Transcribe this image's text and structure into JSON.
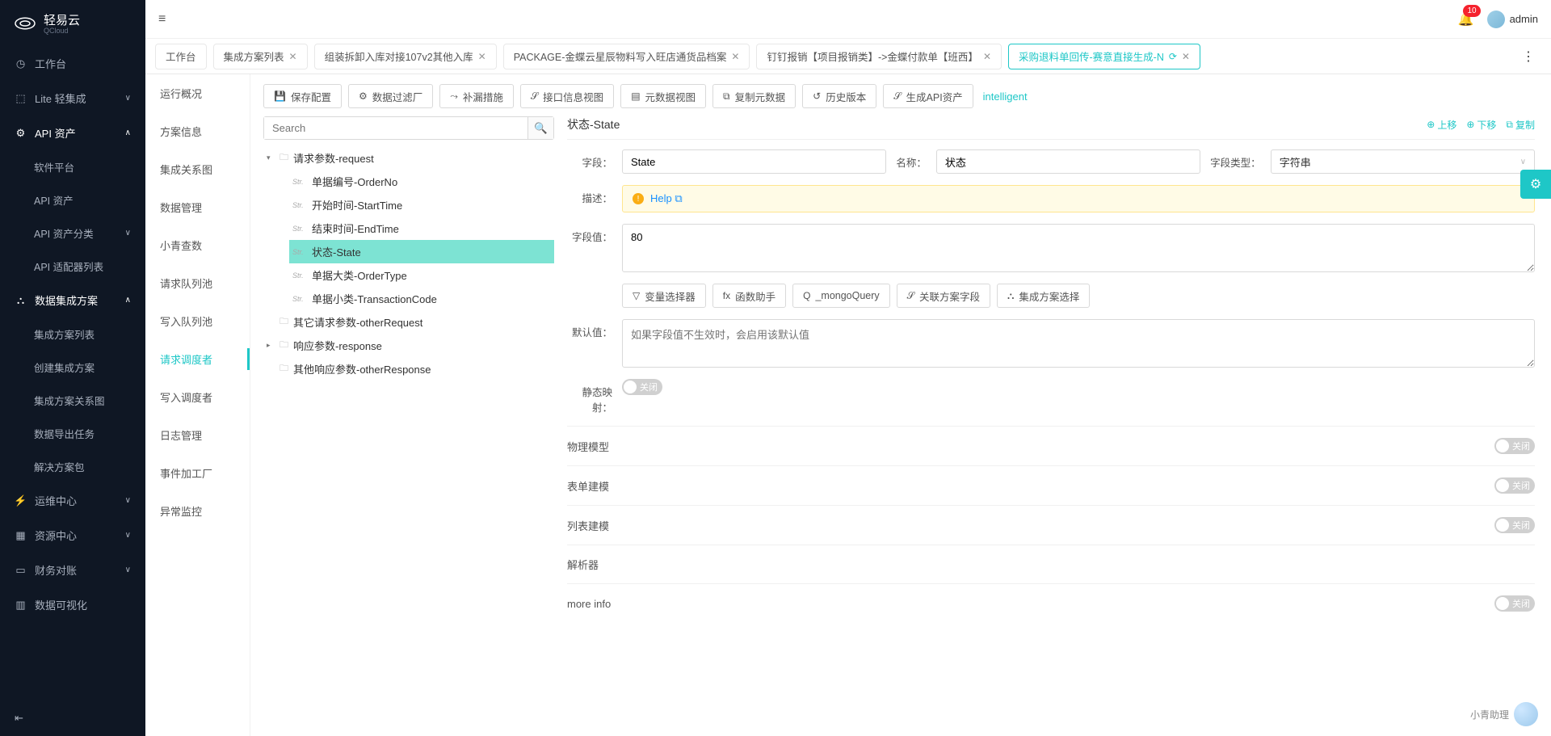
{
  "brand": {
    "name": "轻易云",
    "sub": "QCloud"
  },
  "header": {
    "badge": "10",
    "user": "admin"
  },
  "sidebar": {
    "items": [
      {
        "label": "工作台"
      },
      {
        "label": "Lite 轻集成"
      },
      {
        "label": "API 资产",
        "expanded": true,
        "children": [
          {
            "label": "软件平台"
          },
          {
            "label": "API 资产"
          },
          {
            "label": "API 资产分类",
            "chev": true
          },
          {
            "label": "API 适配器列表"
          }
        ]
      },
      {
        "label": "数据集成方案",
        "expanded": true,
        "children": [
          {
            "label": "集成方案列表"
          },
          {
            "label": "创建集成方案"
          },
          {
            "label": "集成方案关系图"
          },
          {
            "label": "数据导出任务"
          },
          {
            "label": "解决方案包"
          }
        ]
      },
      {
        "label": "运维中心",
        "chev": true
      },
      {
        "label": "资源中心",
        "chev": true
      },
      {
        "label": "财务对账",
        "chev": true
      },
      {
        "label": "数据可视化"
      }
    ]
  },
  "tabs": [
    {
      "label": "工作台",
      "closable": false
    },
    {
      "label": "集成方案列表",
      "closable": true
    },
    {
      "label": "组装拆卸入库对接107v2其他入库",
      "closable": true
    },
    {
      "label": "PACKAGE-金蝶云星辰物料写入旺店通货品档案",
      "closable": true
    },
    {
      "label": "钉钉报销【项目报销类】->金蝶付款单【班西】",
      "closable": true
    },
    {
      "label": "采购退料单回传-赛意直接生成-N",
      "closable": true,
      "active": true,
      "reload": true
    }
  ],
  "secNav": [
    "运行概况",
    "方案信息",
    "集成关系图",
    "数据管理",
    "小青查数",
    "请求队列池",
    "写入队列池",
    "请求调度者",
    "写入调度者",
    "日志管理",
    "事件加工厂",
    "异常监控"
  ],
  "secNavActive": "请求调度者",
  "toolbar": {
    "save": "保存配置",
    "filter": "数据过滤厂",
    "patch": "补漏措施",
    "apiview": "接口信息视图",
    "metaview": "元数据视图",
    "copymeta": "复制元数据",
    "history": "历史版本",
    "genapi": "生成API资产",
    "intelligent": "intelligent"
  },
  "search": {
    "placeholder": "Search"
  },
  "tree": {
    "request": {
      "label": "请求参数-request",
      "items": [
        "单据编号-OrderNo",
        "开始时间-StartTime",
        "结束时间-EndTime",
        "状态-State",
        "单据大类-OrderType",
        "单据小类-TransactionCode"
      ],
      "selected": "状态-State"
    },
    "otherRequest": "其它请求参数-otherRequest",
    "response": "响应参数-response",
    "otherResponse": "其他响应参数-otherResponse"
  },
  "form": {
    "title": "状态-State",
    "actions": {
      "up": "上移",
      "down": "下移",
      "copy": "复制"
    },
    "labels": {
      "field": "字段：",
      "name": "名称：",
      "type": "字段类型：",
      "desc": "描述：",
      "value": "字段值：",
      "default": "默认值：",
      "staticmap": "静态映射："
    },
    "field_value": "State",
    "name_value": "状态",
    "type_value": "字符串",
    "help": "Help",
    "value_value": "80",
    "default_placeholder": "如果字段值不生效时，会启用该默认值",
    "fnBtns": {
      "var": "变量选择器",
      "fx": "函数助手",
      "mongo": "_mongoQuery",
      "rel": "关联方案字段",
      "plan": "集成方案选择"
    },
    "toggle_off": "关闭",
    "sections": [
      "物理模型",
      "表单建模",
      "列表建模",
      "解析器",
      "more info"
    ]
  },
  "assistant": "小青助理"
}
